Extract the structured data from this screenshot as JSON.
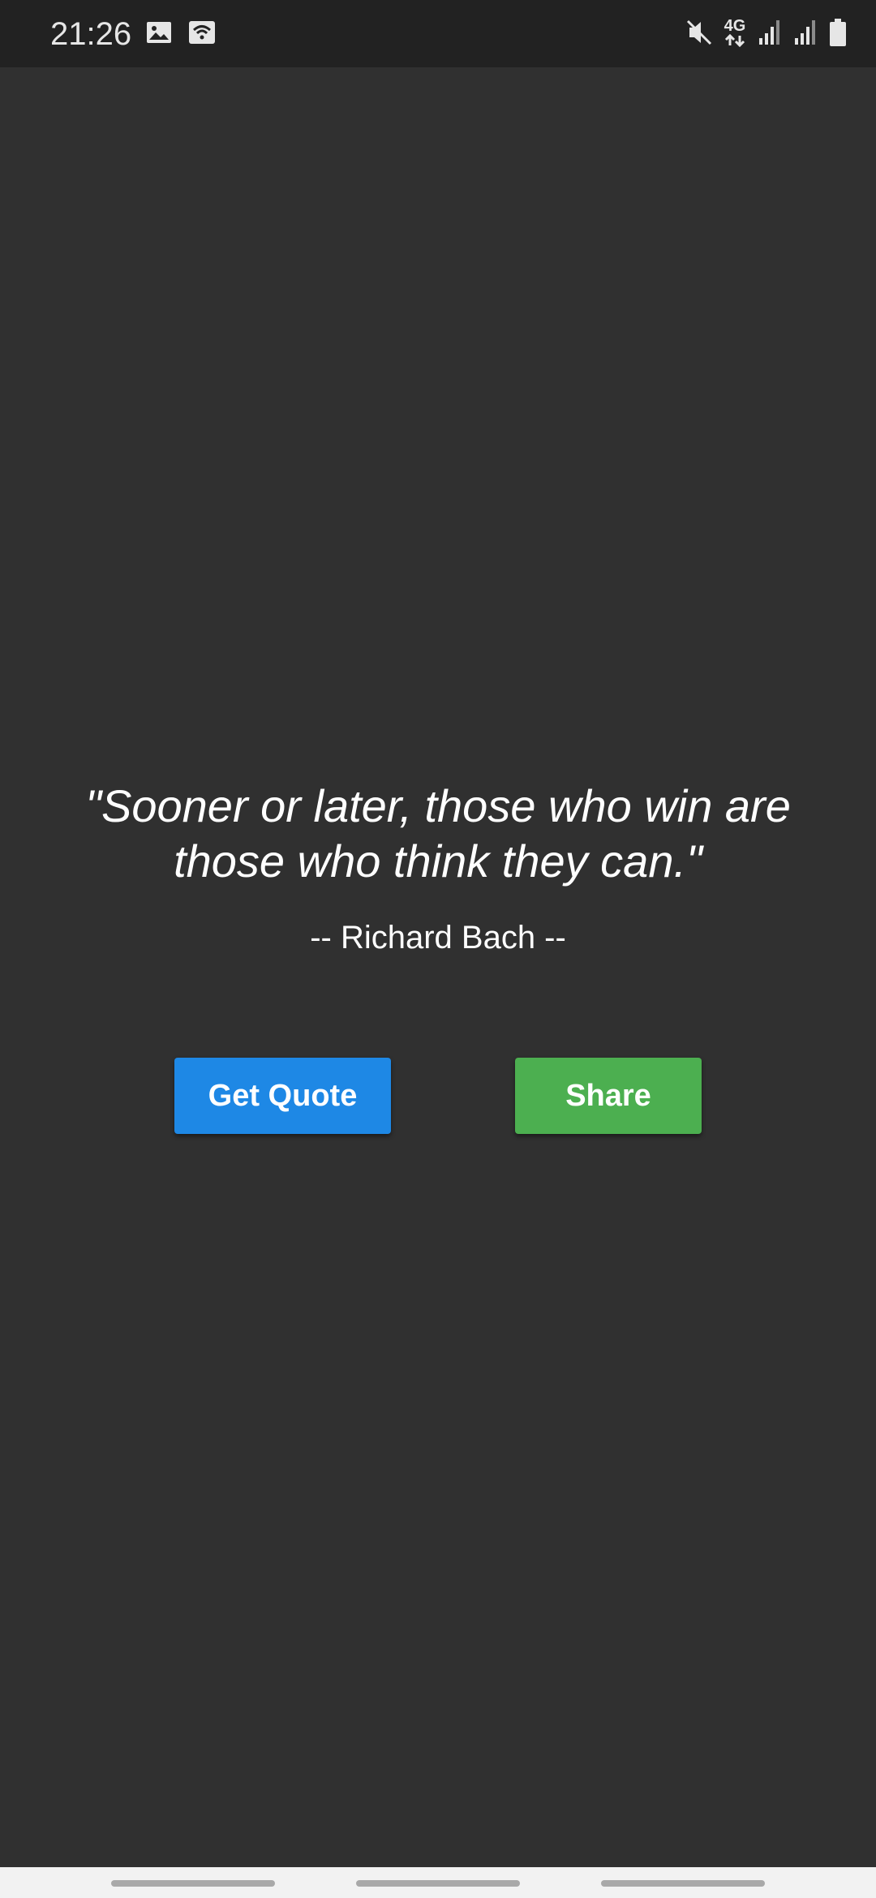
{
  "status_bar": {
    "time": "21:26",
    "left_icons": [
      "image-icon",
      "wifi-calling-icon"
    ],
    "right_icons": [
      "mute-icon",
      "4g-data-icon",
      "signal-icon",
      "signal-icon",
      "battery-icon"
    ],
    "network_label": "4G"
  },
  "quote": {
    "text": "\"Sooner or later, those who win are those who think they can.\"",
    "author": "-- Richard Bach --"
  },
  "buttons": {
    "get_quote": "Get Quote",
    "share": "Share"
  },
  "colors": {
    "background": "#303030",
    "status_bar": "#222222",
    "get_quote_button": "#1e88e5",
    "share_button": "#4caf50",
    "nav_bar": "#f2f2f2"
  }
}
